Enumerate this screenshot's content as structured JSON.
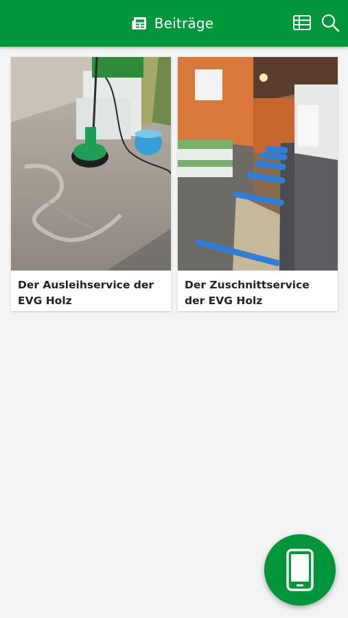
{
  "header": {
    "title": "Beiträge",
    "title_icon": "newspaper-icon",
    "actions": [
      {
        "icon": "list-view-icon"
      },
      {
        "icon": "search-icon"
      }
    ]
  },
  "posts": [
    {
      "title": "Der Ausleihservice der EVG Holz",
      "image": "floor-cleaning-machine-photo"
    },
    {
      "title": "Der Zuschnittservice der EVG Holz",
      "image": "warehouse-roller-conveyor-photo"
    }
  ],
  "fab": {
    "icon": "smartphone-icon"
  },
  "colors": {
    "primary": "#00963a",
    "background": "#f4f4f4",
    "card": "#ffffff",
    "text": "#222222"
  }
}
